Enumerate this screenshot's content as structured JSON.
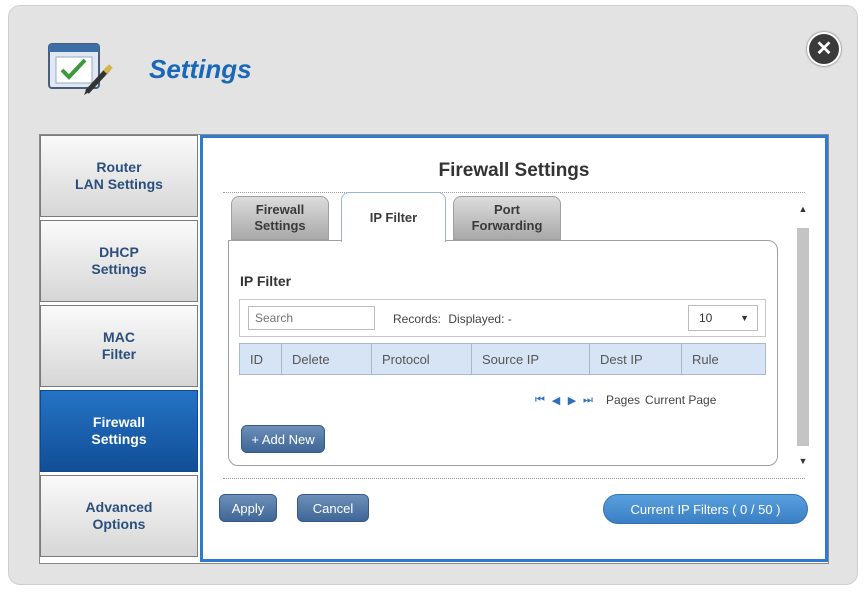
{
  "app": {
    "title": "Settings"
  },
  "icons": {
    "logo": "settings-checklist-icon",
    "close": "close-icon"
  },
  "sidebar": {
    "items": [
      {
        "label": "Router\nLAN Settings"
      },
      {
        "label": "DHCP\nSettings"
      },
      {
        "label": "MAC\nFilter"
      },
      {
        "label": "Firewall\nSettings",
        "active": true
      },
      {
        "label": "Advanced\nOptions"
      }
    ]
  },
  "content": {
    "title": "Firewall Settings",
    "tabs": [
      {
        "label": "Firewall\nSettings"
      },
      {
        "label": "IP Filter",
        "active": true
      },
      {
        "label": "Port\nForwarding"
      }
    ],
    "section_title": "IP Filter",
    "search": {
      "placeholder": "Search"
    },
    "records": {
      "label": "Records:",
      "displayed": "Displayed: -"
    },
    "page_size": {
      "value": "10"
    },
    "table": {
      "columns": [
        "ID",
        "Delete",
        "Protocol",
        "Source IP",
        "Dest IP",
        "Rule"
      ]
    },
    "pager": {
      "pages": "Pages",
      "current": "Current Page"
    },
    "add_new_label": "+ Add New"
  },
  "footer": {
    "apply_label": "Apply",
    "cancel_label": "Cancel",
    "current_filters_label": "Current IP Filters ( 0 / 50 )"
  },
  "colors": {
    "accent": "#2d7ad0",
    "active_nav": "#1a5ca8",
    "title": "#1a67b8"
  }
}
